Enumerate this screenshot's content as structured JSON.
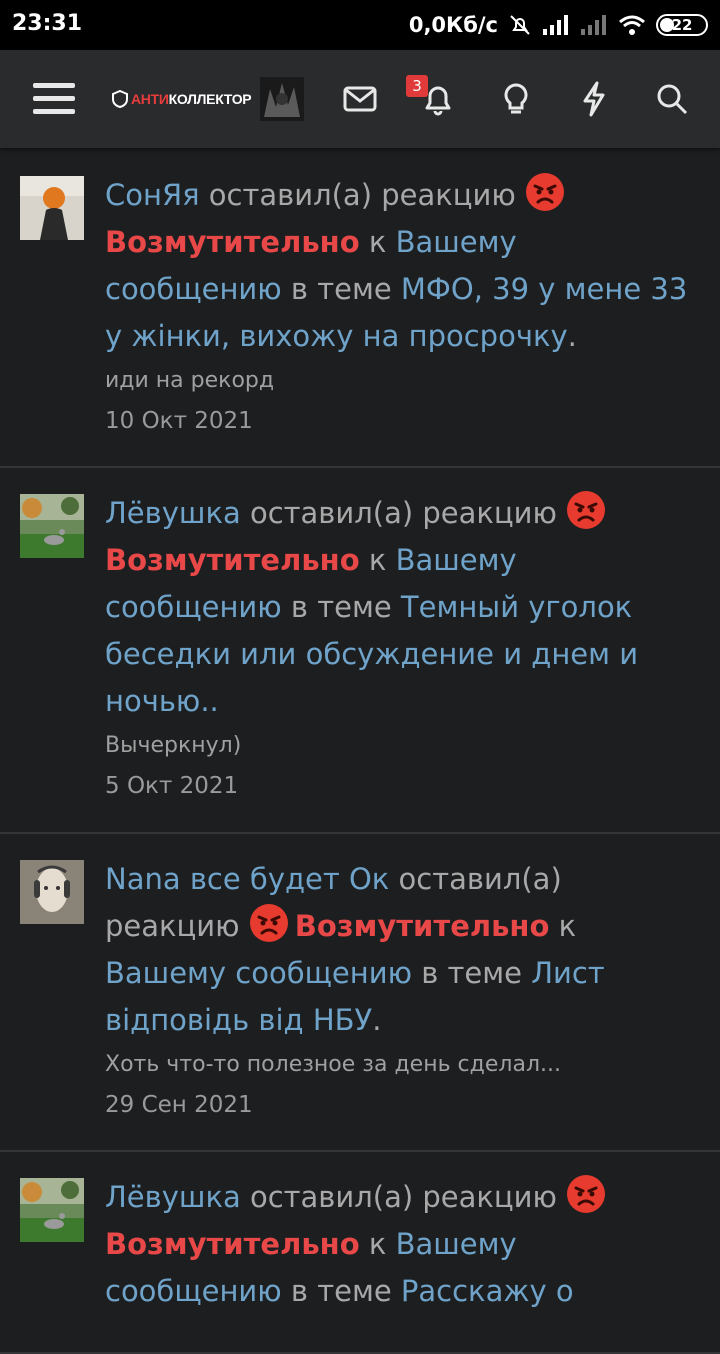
{
  "status_bar": {
    "time": "23:31",
    "speed": "0,0Кб/с",
    "battery": "22"
  },
  "header": {
    "logo_part1": "АНТИ",
    "logo_part2": "КОЛЛЕКТОР",
    "notification_count": "3",
    "icons": [
      "menu-icon",
      "mail-icon",
      "bell-icon",
      "lightbulb-icon",
      "lightning-icon",
      "search-icon"
    ]
  },
  "feed": {
    "items": [
      {
        "user": "СонЯя",
        "action": "оставил(а) реакцию",
        "reaction": "Возмутительно",
        "prep": "к",
        "target": "Вашему сообщению",
        "in_topic": "в теме",
        "topic": "МФО, 39 у мене 33 у жінки, вихожу на просрочку",
        "snippet": "иди на рекорд",
        "date": "10 Окт 2021"
      },
      {
        "user": "Лёвушка",
        "action": "оставил(а) реакцию",
        "reaction": "Возмутительно",
        "prep": "к",
        "target": "Вашему сообщению",
        "in_topic": "в теме",
        "topic": "Темный уголок беседки или обсуждение и днем и ночью..",
        "snippet": "Вычеркнул)",
        "date": "5 Окт 2021"
      },
      {
        "user": "Nana все будет Ок",
        "action": "оставил(а) реакцию",
        "reaction": "Возмутительно",
        "prep": "к",
        "target": "Вашему сообщению",
        "in_topic": "в теме",
        "topic": "Лист відповідь від НБУ",
        "snippet": "Хоть что-то полезное за день сделал...",
        "date": "29 Сен 2021"
      },
      {
        "user": "Лёвушка",
        "action": "оставил(а) реакцию",
        "reaction": "Возмутительно",
        "prep": "к",
        "target": "Вашему сообщению",
        "in_topic": "в теме",
        "topic": "Расскажу о",
        "snippet": "",
        "date": ""
      }
    ]
  }
}
